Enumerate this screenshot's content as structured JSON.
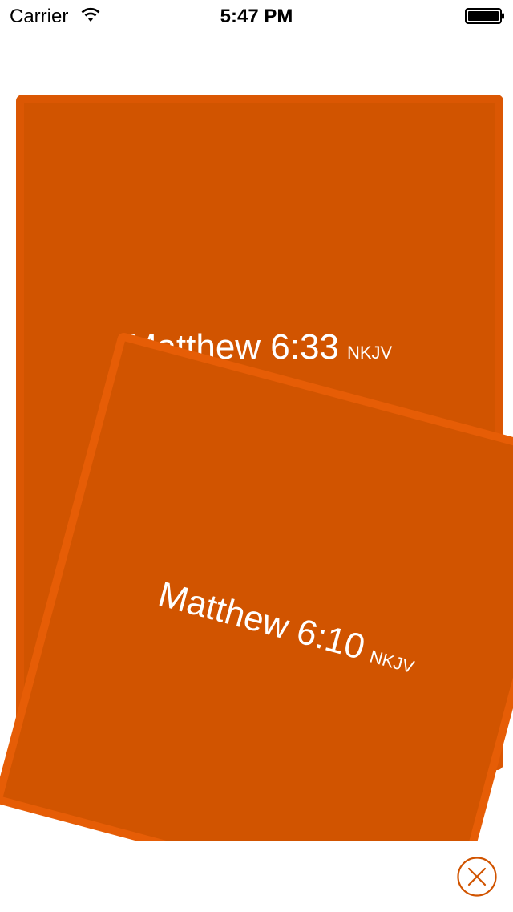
{
  "status_bar": {
    "carrier": "Carrier",
    "time": "5:47 PM",
    "icons": [
      "wifi-icon",
      "battery-icon"
    ]
  },
  "cards": [
    {
      "reference": "Matthew 6:33",
      "version": "NKJV",
      "position": "back"
    },
    {
      "reference": "Matthew 6:10",
      "version": "NKJV",
      "position": "front"
    }
  ],
  "bottom_bar": {
    "close_icon": "close-circle-icon"
  },
  "colors": {
    "card": "#d15400",
    "card_border": "#e25a05",
    "accent": "#d15400",
    "text_on_card": "#ffffff"
  }
}
